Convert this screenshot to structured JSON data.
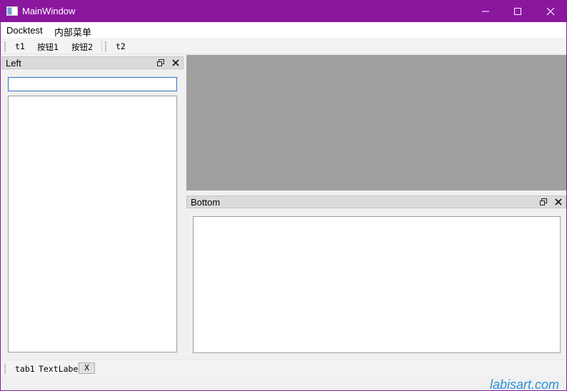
{
  "window": {
    "title": "MainWindow",
    "accent_color": "#8b179f",
    "icons": {
      "app": "window-app-icon",
      "minimize": "minimize-icon",
      "maximize": "maximize-icon",
      "close": "close-icon"
    }
  },
  "menubar": {
    "items": [
      {
        "label": "Docktest"
      },
      {
        "label": "内部菜单"
      }
    ]
  },
  "toolbar": {
    "groups": [
      {
        "buttons": [
          {
            "label": "t1"
          },
          {
            "label": "按钮1"
          },
          {
            "label": "按钮2"
          }
        ]
      },
      {
        "buttons": [
          {
            "label": "t2"
          }
        ]
      }
    ]
  },
  "left_dock": {
    "title": "Left",
    "search_input": {
      "value": "",
      "placeholder": ""
    },
    "list_items": []
  },
  "central_area": {
    "background": "#a0a0a0"
  },
  "bottom_dock": {
    "title": "Bottom",
    "text_content": ""
  },
  "bottom_toolbar": {
    "tab_label": "tab1",
    "text_label": "TextLabel",
    "x_button_label": "X"
  },
  "watermark": "labisart.com"
}
